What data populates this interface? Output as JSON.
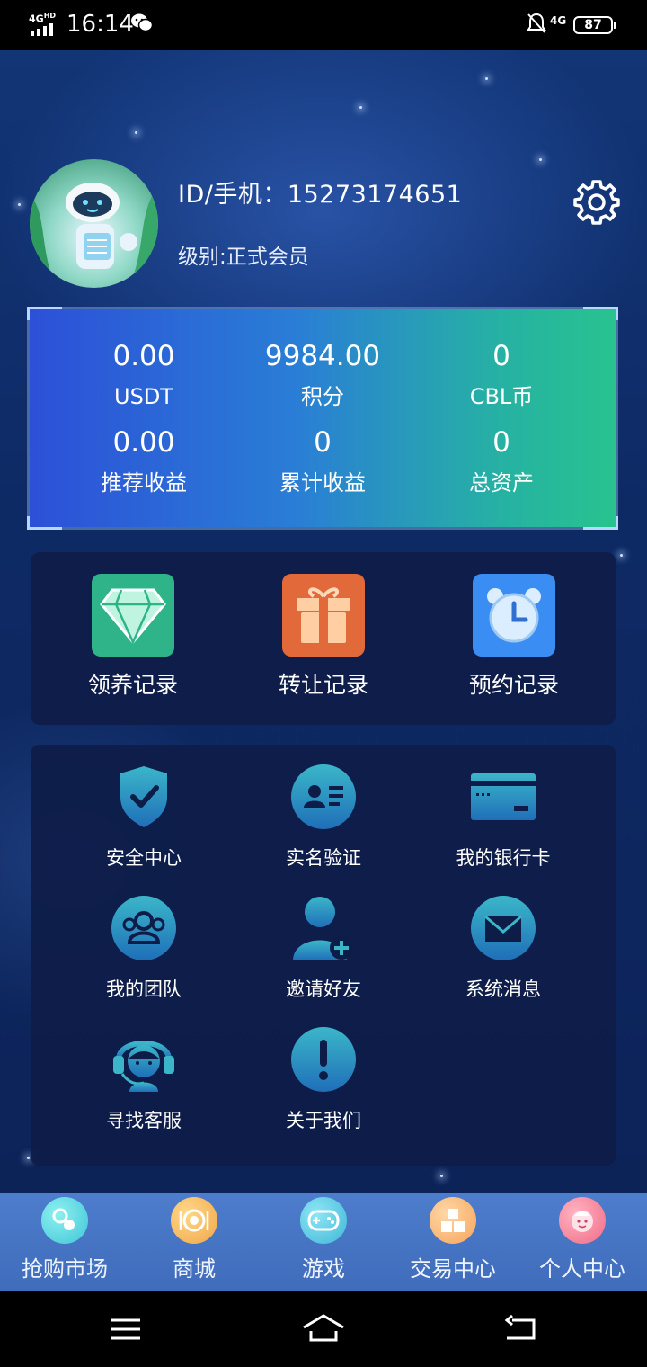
{
  "status_bar": {
    "time": "16:14",
    "network_left": "4G",
    "network_left_sup": "HD",
    "network_right": "4G",
    "battery": "87"
  },
  "profile": {
    "id_label": "ID/手机：15273174651",
    "level_label": "级别:正式会员"
  },
  "assets": [
    {
      "value": "0.00",
      "label": "USDT"
    },
    {
      "value": "9984.00",
      "label": "积分"
    },
    {
      "value": "0",
      "label": "CBL币"
    },
    {
      "value": "0.00",
      "label": "推荐收益"
    },
    {
      "value": "0",
      "label": "累计收益"
    },
    {
      "value": "0",
      "label": "总资产"
    }
  ],
  "records": [
    {
      "label": "领养记录",
      "icon": "diamond-icon",
      "color": "#2fb48a"
    },
    {
      "label": "转让记录",
      "icon": "gift-icon",
      "color": "#e2693a"
    },
    {
      "label": "预约记录",
      "icon": "alarm-clock-icon",
      "color": "#3a8df2"
    }
  ],
  "services": [
    {
      "label": "安全中心",
      "icon": "shield-check-icon"
    },
    {
      "label": "实名验证",
      "icon": "id-card-icon"
    },
    {
      "label": "我的银行卡",
      "icon": "bank-card-icon"
    },
    {
      "label": "我的团队",
      "icon": "team-icon"
    },
    {
      "label": "邀请好友",
      "icon": "add-user-icon"
    },
    {
      "label": "系统消息",
      "icon": "mail-icon"
    },
    {
      "label": "寻找客服",
      "icon": "headset-icon"
    },
    {
      "label": "关于我们",
      "icon": "info-icon"
    }
  ],
  "tabs": [
    {
      "label": "抢购市场",
      "icon": "pacifier-icon",
      "color": "#3fc6d6"
    },
    {
      "label": "商城",
      "icon": "plate-icon",
      "color": "#f0a64a"
    },
    {
      "label": "游戏",
      "icon": "gamepad-icon",
      "color": "#3fb7d8"
    },
    {
      "label": "交易中心",
      "icon": "boxes-icon",
      "color": "#f5a45a"
    },
    {
      "label": "个人中心",
      "icon": "baby-face-icon",
      "color": "#f06b86"
    }
  ],
  "colors": {
    "icon_teal": "#3bb6c9",
    "icon_blue": "#1f6fb8"
  }
}
